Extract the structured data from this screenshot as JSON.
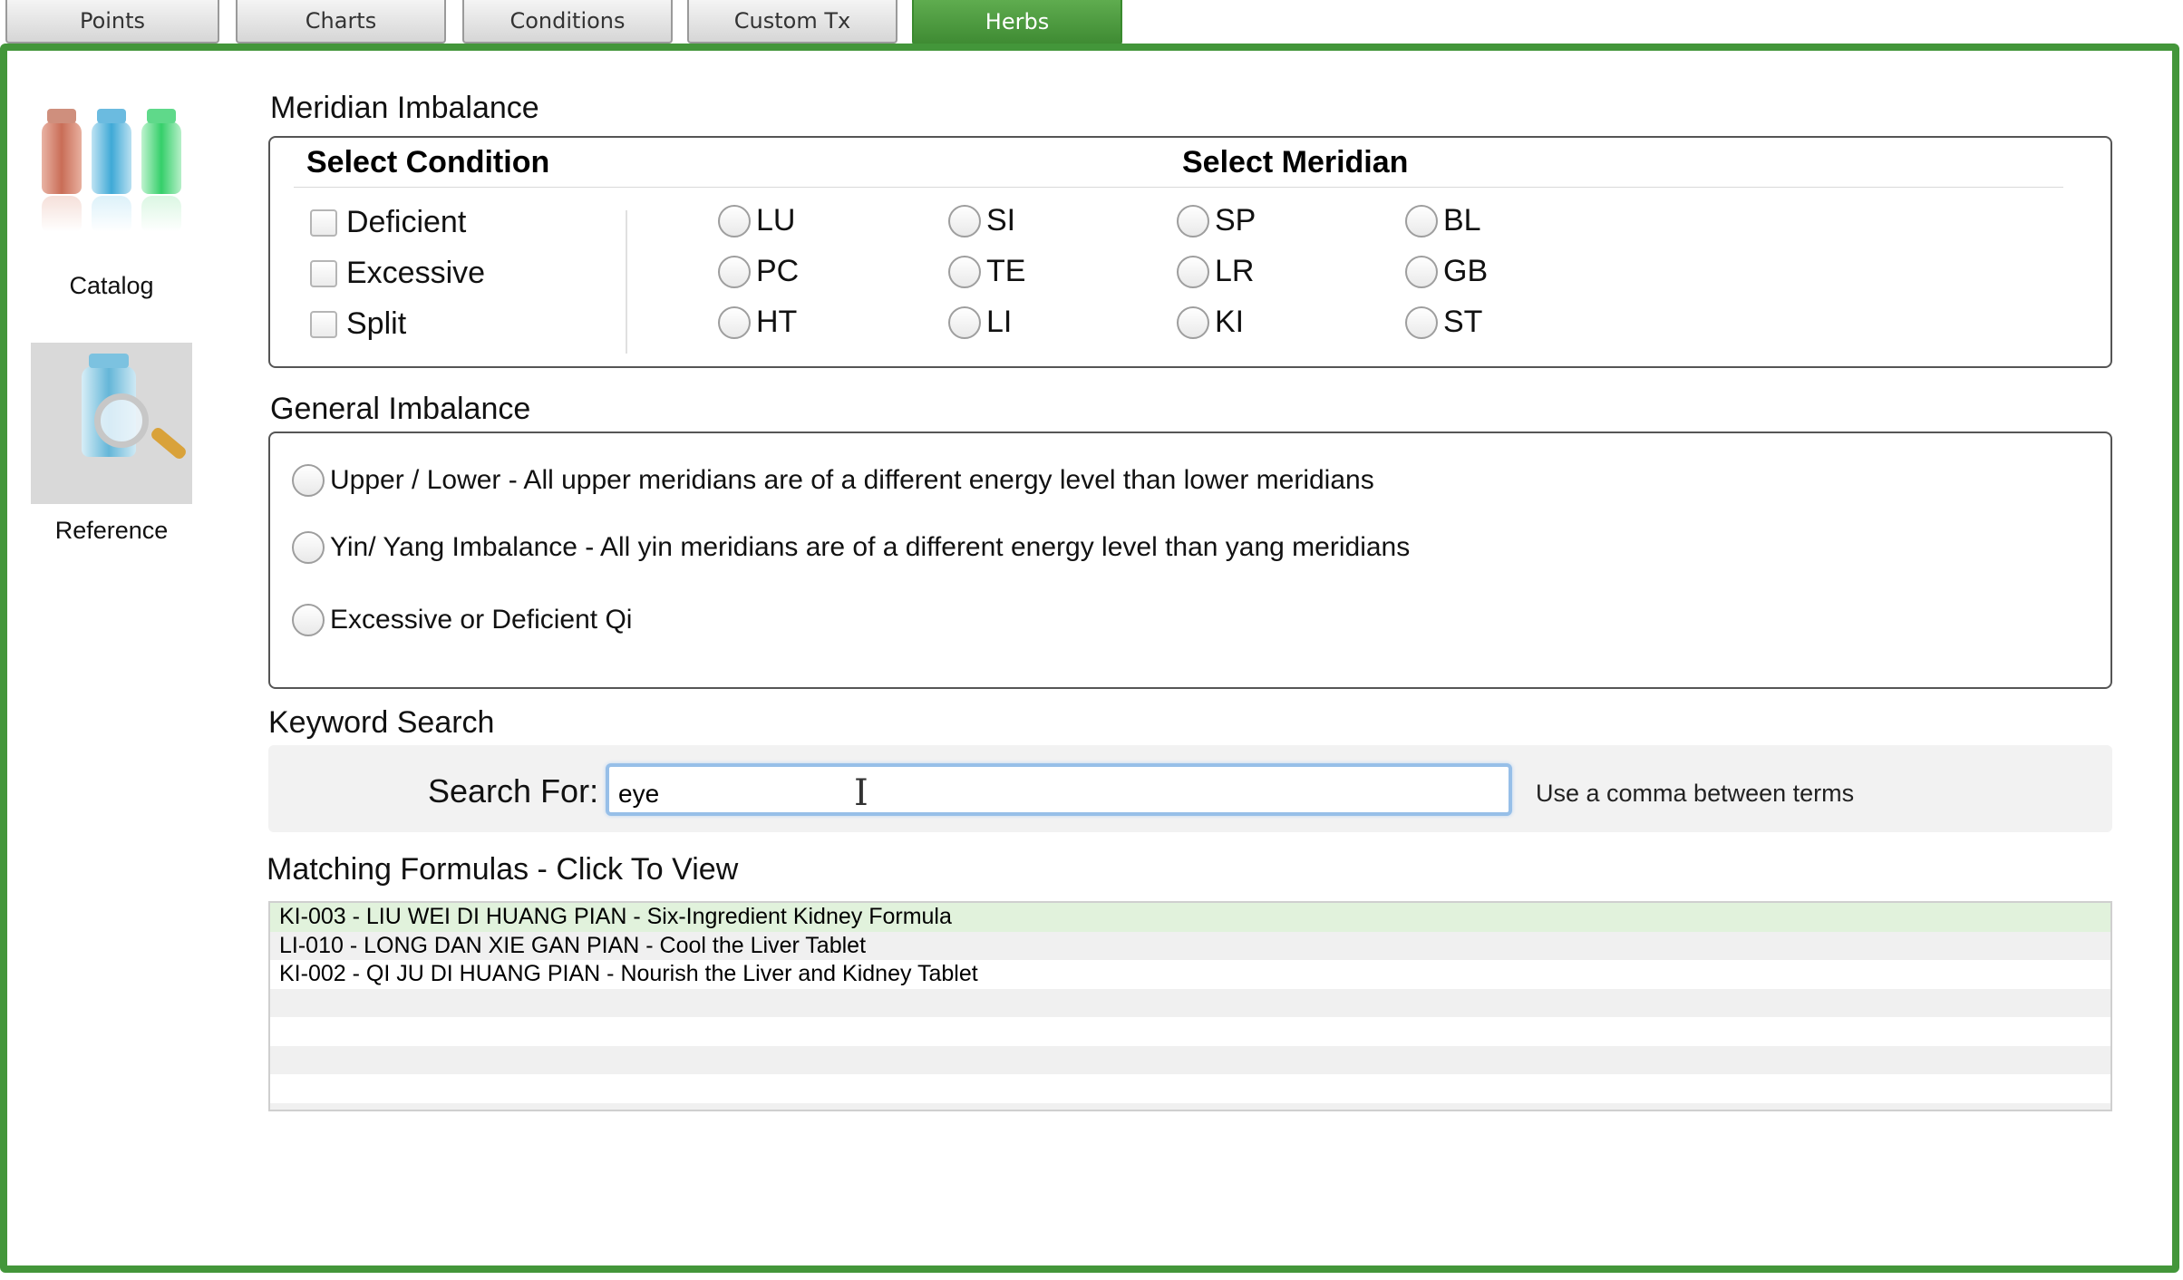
{
  "tabs": [
    {
      "label": "Points",
      "active": false
    },
    {
      "label": "Charts",
      "active": false
    },
    {
      "label": "Conditions",
      "active": false
    },
    {
      "label": "Custom Tx",
      "active": false
    },
    {
      "label": "Herbs",
      "active": true
    }
  ],
  "sidebar": {
    "items": [
      {
        "label": "Catalog",
        "icon": "bottles-icon"
      },
      {
        "label": "Reference",
        "icon": "magnifier-bottle-icon"
      }
    ]
  },
  "meridian_imbalance": {
    "title": "Meridian Imbalance",
    "condition_heading": "Select Condition",
    "meridian_heading": "Select Meridian",
    "conditions": [
      "Deficient",
      "Excessive",
      "Split"
    ],
    "meridians": [
      "LU",
      "SI",
      "SP",
      "BL",
      "PC",
      "TE",
      "LR",
      "GB",
      "HT",
      "LI",
      "KI",
      "ST"
    ]
  },
  "general_imbalance": {
    "title": "General Imbalance",
    "options": [
      "Upper / Lower - All upper meridians are of a different energy level than lower meridians",
      "Yin/ Yang Imbalance - All yin meridians are of a different energy level than yang meridians",
      "Excessive or Deficient Qi"
    ]
  },
  "keyword_search": {
    "title": "Keyword Search",
    "label": "Search For:",
    "value": "eye",
    "hint": "Use a comma between terms"
  },
  "results": {
    "title": "Matching Formulas - Click To View",
    "rows": [
      "KI-003 - LIU WEI DI HUANG PIAN - Six-Ingredient Kidney Formula",
      "LI-010 - LONG DAN XIE GAN PIAN - Cool the Liver Tablet",
      "KI-002 - QI JU DI HUANG PIAN - Nourish the Liver and Kidney Tablet",
      "",
      "",
      "",
      "",
      ""
    ],
    "selected_index": 0
  },
  "colors": {
    "accent_green": "#43963a",
    "selected_row": "#e1f2dc",
    "focus_blue": "#97bfe8"
  }
}
